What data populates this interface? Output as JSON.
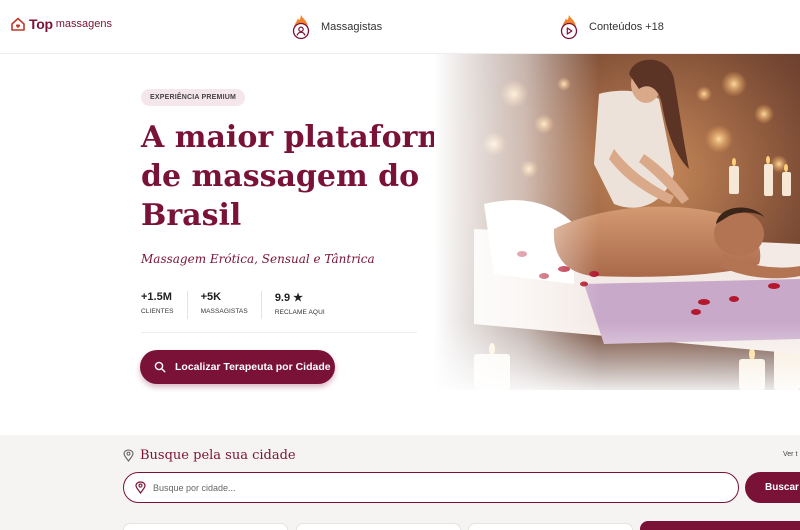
{
  "header": {
    "logo": {
      "bold": "Top",
      "rest": "massagens",
      "icon": "house-heart-icon"
    },
    "nav": [
      {
        "label": "Massagistas",
        "icon": "flame-user-icon"
      },
      {
        "label": "Conteúdos +18",
        "icon": "flame-play-icon"
      }
    ]
  },
  "hero": {
    "badge": "EXPERIÊNCIA PREMIUM",
    "headline": {
      "line1_prefix": "A ",
      "line1_strong": "maior plataforma",
      "line2": "de massagem do",
      "line3": "Brasil"
    },
    "subtitle": "Massagem Erótica, Sensual e Tântrica",
    "stats": [
      {
        "value": "+1.5M",
        "label": "CLIENTES"
      },
      {
        "value": "+5K",
        "label": "MASSAGISTAS"
      },
      {
        "value": "9.9 ★",
        "label": "RECLAME AQUI"
      }
    ],
    "cta_label": "Localizar Terapeuta por Cidade",
    "cta_icon": "search-icon",
    "image": "massage-photo"
  },
  "search": {
    "title": "Busque pela sua cidade",
    "title_icon": "map-pin-icon",
    "ver_todas": "Ver t",
    "input_icon": "map-pin-icon",
    "placeholder": "Busque por cidade...",
    "value": "",
    "button_label": "Buscar"
  },
  "colors": {
    "brand": "#7a1238",
    "badge_bg": "#f4e6ea",
    "section_bg": "#f5f4f2"
  }
}
